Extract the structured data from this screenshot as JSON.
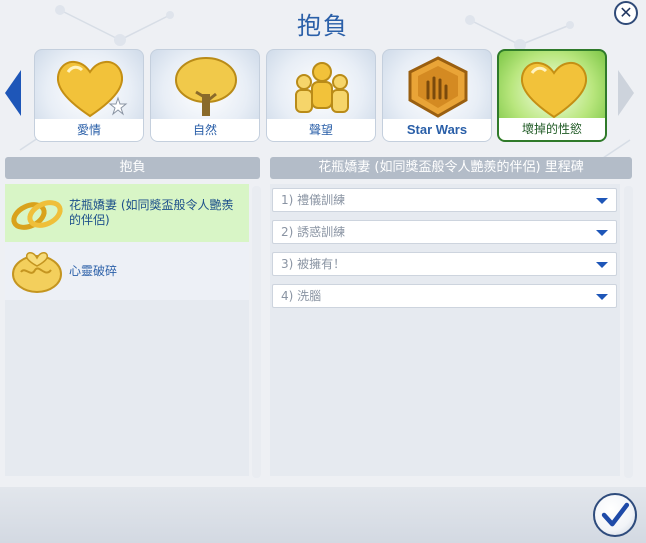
{
  "dialog": {
    "title": "抱負"
  },
  "categories": [
    {
      "label": "愛情",
      "icon": "heart-icon",
      "selected": false
    },
    {
      "label": "自然",
      "icon": "tree-icon",
      "selected": false
    },
    {
      "label": "聲望",
      "icon": "crowd-icon",
      "selected": false
    },
    {
      "label": "Star Wars",
      "icon": "star-wars-hand-icon",
      "selected": false
    },
    {
      "label": "壞掉的性慾",
      "icon": "heart-icon",
      "selected": true
    }
  ],
  "left_panel": {
    "header": "抱負"
  },
  "aspirations": [
    {
      "label": "花瓶嬌妻 (如同獎盃般令人艷羨的伴侶)",
      "icon": "rings-icon",
      "selected": true
    },
    {
      "label": "心靈破碎",
      "icon": "brain-heart-icon",
      "selected": false
    }
  ],
  "right_panel": {
    "header": "花瓶嬌妻 (如同獎盃般令人艷羨的伴侶) 里程碑"
  },
  "milestones": [
    {
      "label": "1) 禮儀訓練"
    },
    {
      "label": "2) 誘惑訓練"
    },
    {
      "label": "3) 被擁有！"
    },
    {
      "label": "4) 洗腦"
    }
  ],
  "colors": {
    "accent": "#2a5fa8",
    "selected_green": "#2f7a2a",
    "header_gray": "#b3bcc8"
  }
}
